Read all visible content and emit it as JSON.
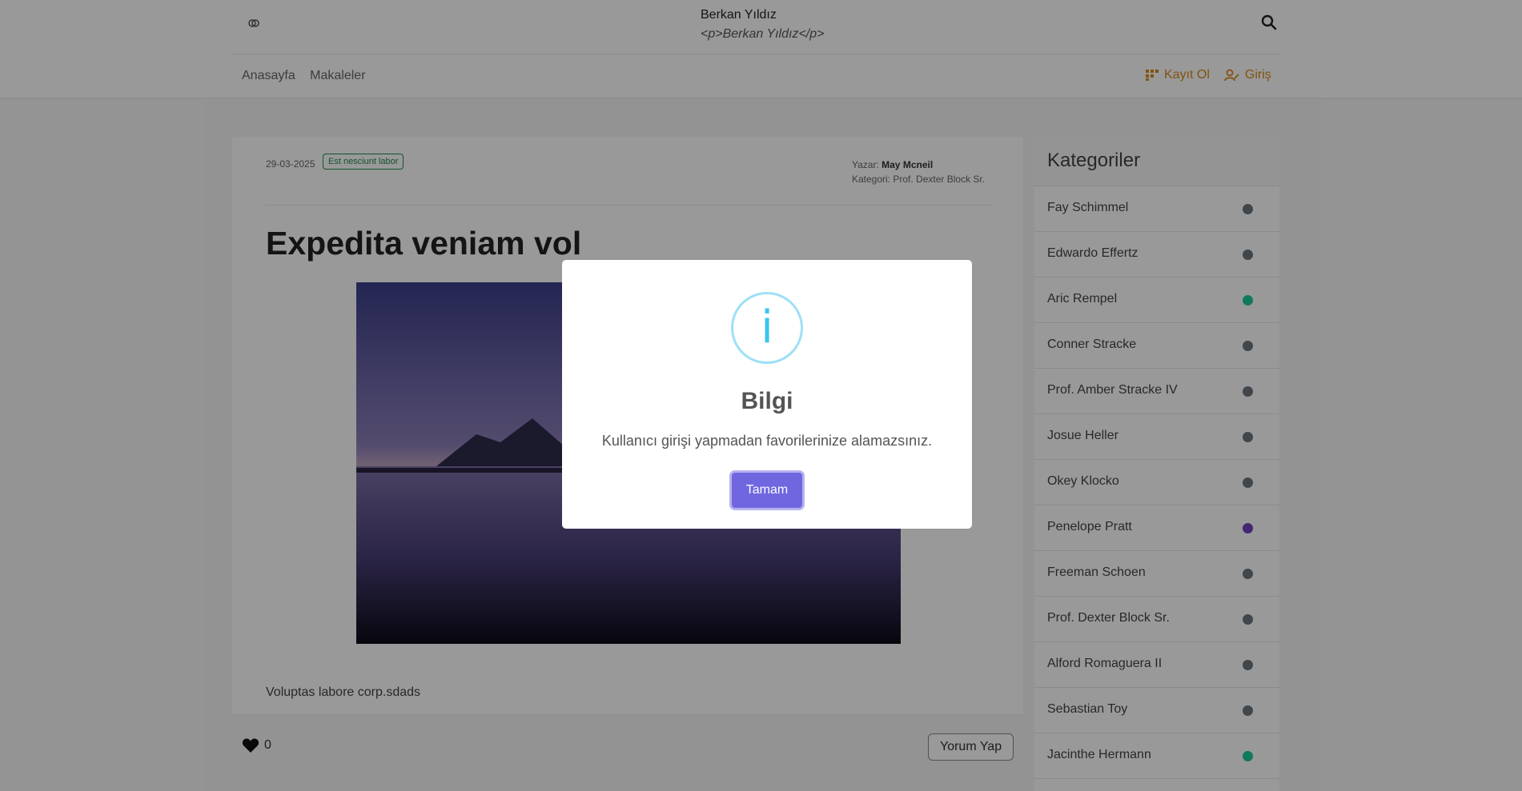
{
  "header": {
    "title": "Berkan Yıldız",
    "subtitle": "<p>Berkan Yıldız</p>",
    "nav": [
      "Anasayfa",
      "Makaleler"
    ],
    "register_label": "Kayıt Ol",
    "login_label": "Giriş",
    "accent": "#d68a1a"
  },
  "article": {
    "date": "29-03-2025",
    "tag": "Est nesciunt labor",
    "author_label": "Yazar:",
    "author": "May Mcneil",
    "category_label": "Kategori:",
    "category": "Prof. Dexter Block Sr.",
    "title": "Expedita veniam vol",
    "description": "Voluptas labore corp.sdads",
    "like_count": "0",
    "comment_label": "Yorum Yap"
  },
  "sidebar": {
    "title": "Kategoriler",
    "items": [
      {
        "label": "Fay Schimmel",
        "color": "#6c757d"
      },
      {
        "label": "Edwardo Effertz",
        "color": "#6c757d"
      },
      {
        "label": "Aric Rempel",
        "color": "#20c997"
      },
      {
        "label": "Conner Stracke",
        "color": "#6c757d"
      },
      {
        "label": "Prof. Amber Stracke IV",
        "color": "#6c757d"
      },
      {
        "label": "Josue Heller",
        "color": "#6c757d"
      },
      {
        "label": "Okey Klocko",
        "color": "#6c757d"
      },
      {
        "label": "Penelope Pratt",
        "color": "#6f42c1"
      },
      {
        "label": "Freeman Schoen",
        "color": "#6c757d"
      },
      {
        "label": "Prof. Dexter Block Sr.",
        "color": "#6c757d"
      },
      {
        "label": "Alford Romaguera II",
        "color": "#6c757d"
      },
      {
        "label": "Sebastian Toy",
        "color": "#6c757d"
      },
      {
        "label": "Jacinthe Hermann",
        "color": "#20c997"
      }
    ]
  },
  "modal": {
    "icon": "info-icon",
    "title": "Bilgi",
    "text": "Kullanıcı girişi yapmadan favorilerinize alamazsınız.",
    "confirm_label": "Tamam",
    "button_color": "#7066e0"
  }
}
